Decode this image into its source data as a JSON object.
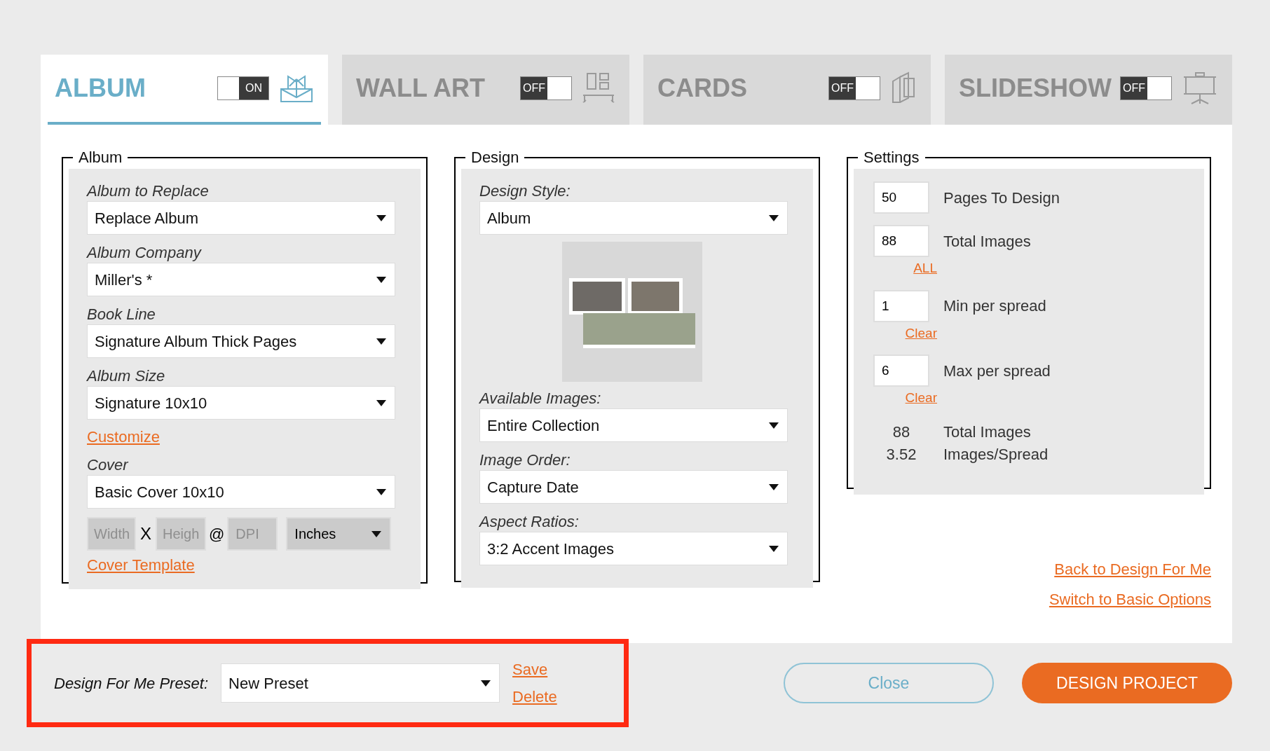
{
  "tabs": [
    {
      "label": "ALBUM",
      "selected": true,
      "on": true,
      "toggle_label": "ON"
    },
    {
      "label": "WALL ART",
      "selected": false,
      "on": false,
      "toggle_label": "OFF"
    },
    {
      "label": "CARDS",
      "selected": false,
      "on": false,
      "toggle_label": "OFF"
    },
    {
      "label": "SLIDESHOW",
      "selected": false,
      "on": false,
      "toggle_label": "OFF"
    }
  ],
  "album": {
    "title": "Album",
    "fields": [
      {
        "label": "Album to Replace",
        "value": "Replace Album"
      },
      {
        "label": "Album Company",
        "value": "Miller's *"
      },
      {
        "label": "Book Line",
        "value": "Signature Album Thick Pages"
      },
      {
        "label": "Album Size",
        "value": "Signature 10x10"
      }
    ],
    "customize_link": "Customize",
    "cover": {
      "label": "Cover",
      "value": "Basic Cover 10x10"
    },
    "dimensions": {
      "width_placeholder": "Width",
      "times": "X",
      "height_placeholder": "Heigh",
      "at": "@",
      "dpi_placeholder": "DPI",
      "unit": "Inches"
    },
    "cover_template_link": "Cover Template"
  },
  "design": {
    "title": "Design",
    "style": {
      "label": "Design Style:",
      "value": "Album"
    },
    "fields": [
      {
        "label": "Available Images:",
        "value": "Entire Collection"
      },
      {
        "label": "Image Order:",
        "value": "Capture Date"
      },
      {
        "label": "Aspect Ratios:",
        "value": "3:2 Accent Images"
      }
    ]
  },
  "settings": {
    "title": "Settings",
    "rows": [
      {
        "value": "50",
        "label": "Pages To Design"
      },
      {
        "value": "88",
        "label": "Total Images",
        "link": "ALL"
      },
      {
        "value": "1",
        "label": "Min per spread",
        "link": "Clear"
      },
      {
        "value": "6",
        "label": "Max per spread",
        "link": "Clear"
      }
    ],
    "summary": [
      {
        "value": "88",
        "label": "Total Images"
      },
      {
        "value": "3.52",
        "label": "Images/Spread"
      }
    ]
  },
  "links": [
    "Back to Design For Me",
    "Switch to Basic Options"
  ],
  "footer": {
    "preset_label": "Design For Me Preset:",
    "preset_value": "New Preset",
    "save": "Save",
    "delete": "Delete",
    "close": "Close",
    "design": "DESIGN PROJECT"
  }
}
